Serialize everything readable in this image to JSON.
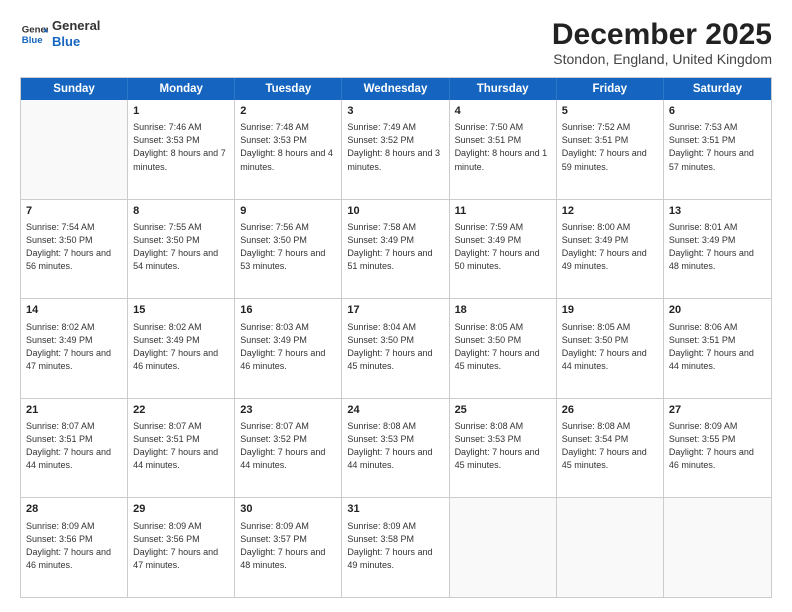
{
  "header": {
    "logo_line1": "General",
    "logo_line2": "Blue",
    "title": "December 2025",
    "subtitle": "Stondon, England, United Kingdom"
  },
  "days_of_week": [
    "Sunday",
    "Monday",
    "Tuesday",
    "Wednesday",
    "Thursday",
    "Friday",
    "Saturday"
  ],
  "weeks": [
    [
      {
        "day": "",
        "empty": true
      },
      {
        "day": "1",
        "sunrise": "7:46 AM",
        "sunset": "3:53 PM",
        "daylight": "8 hours and 7 minutes."
      },
      {
        "day": "2",
        "sunrise": "7:48 AM",
        "sunset": "3:53 PM",
        "daylight": "8 hours and 4 minutes."
      },
      {
        "day": "3",
        "sunrise": "7:49 AM",
        "sunset": "3:52 PM",
        "daylight": "8 hours and 3 minutes."
      },
      {
        "day": "4",
        "sunrise": "7:50 AM",
        "sunset": "3:51 PM",
        "daylight": "8 hours and 1 minute."
      },
      {
        "day": "5",
        "sunrise": "7:52 AM",
        "sunset": "3:51 PM",
        "daylight": "7 hours and 59 minutes."
      },
      {
        "day": "6",
        "sunrise": "7:53 AM",
        "sunset": "3:51 PM",
        "daylight": "7 hours and 57 minutes."
      }
    ],
    [
      {
        "day": "7",
        "sunrise": "7:54 AM",
        "sunset": "3:50 PM",
        "daylight": "7 hours and 56 minutes."
      },
      {
        "day": "8",
        "sunrise": "7:55 AM",
        "sunset": "3:50 PM",
        "daylight": "7 hours and 54 minutes."
      },
      {
        "day": "9",
        "sunrise": "7:56 AM",
        "sunset": "3:50 PM",
        "daylight": "7 hours and 53 minutes."
      },
      {
        "day": "10",
        "sunrise": "7:58 AM",
        "sunset": "3:49 PM",
        "daylight": "7 hours and 51 minutes."
      },
      {
        "day": "11",
        "sunrise": "7:59 AM",
        "sunset": "3:49 PM",
        "daylight": "7 hours and 50 minutes."
      },
      {
        "day": "12",
        "sunrise": "8:00 AM",
        "sunset": "3:49 PM",
        "daylight": "7 hours and 49 minutes."
      },
      {
        "day": "13",
        "sunrise": "8:01 AM",
        "sunset": "3:49 PM",
        "daylight": "7 hours and 48 minutes."
      }
    ],
    [
      {
        "day": "14",
        "sunrise": "8:02 AM",
        "sunset": "3:49 PM",
        "daylight": "7 hours and 47 minutes."
      },
      {
        "day": "15",
        "sunrise": "8:02 AM",
        "sunset": "3:49 PM",
        "daylight": "7 hours and 46 minutes."
      },
      {
        "day": "16",
        "sunrise": "8:03 AM",
        "sunset": "3:49 PM",
        "daylight": "7 hours and 46 minutes."
      },
      {
        "day": "17",
        "sunrise": "8:04 AM",
        "sunset": "3:50 PM",
        "daylight": "7 hours and 45 minutes."
      },
      {
        "day": "18",
        "sunrise": "8:05 AM",
        "sunset": "3:50 PM",
        "daylight": "7 hours and 45 minutes."
      },
      {
        "day": "19",
        "sunrise": "8:05 AM",
        "sunset": "3:50 PM",
        "daylight": "7 hours and 44 minutes."
      },
      {
        "day": "20",
        "sunrise": "8:06 AM",
        "sunset": "3:51 PM",
        "daylight": "7 hours and 44 minutes."
      }
    ],
    [
      {
        "day": "21",
        "sunrise": "8:07 AM",
        "sunset": "3:51 PM",
        "daylight": "7 hours and 44 minutes."
      },
      {
        "day": "22",
        "sunrise": "8:07 AM",
        "sunset": "3:51 PM",
        "daylight": "7 hours and 44 minutes."
      },
      {
        "day": "23",
        "sunrise": "8:07 AM",
        "sunset": "3:52 PM",
        "daylight": "7 hours and 44 minutes."
      },
      {
        "day": "24",
        "sunrise": "8:08 AM",
        "sunset": "3:53 PM",
        "daylight": "7 hours and 44 minutes."
      },
      {
        "day": "25",
        "sunrise": "8:08 AM",
        "sunset": "3:53 PM",
        "daylight": "7 hours and 45 minutes."
      },
      {
        "day": "26",
        "sunrise": "8:08 AM",
        "sunset": "3:54 PM",
        "daylight": "7 hours and 45 minutes."
      },
      {
        "day": "27",
        "sunrise": "8:09 AM",
        "sunset": "3:55 PM",
        "daylight": "7 hours and 46 minutes."
      }
    ],
    [
      {
        "day": "28",
        "sunrise": "8:09 AM",
        "sunset": "3:56 PM",
        "daylight": "7 hours and 46 minutes."
      },
      {
        "day": "29",
        "sunrise": "8:09 AM",
        "sunset": "3:56 PM",
        "daylight": "7 hours and 47 minutes."
      },
      {
        "day": "30",
        "sunrise": "8:09 AM",
        "sunset": "3:57 PM",
        "daylight": "7 hours and 48 minutes."
      },
      {
        "day": "31",
        "sunrise": "8:09 AM",
        "sunset": "3:58 PM",
        "daylight": "7 hours and 49 minutes."
      },
      {
        "day": "",
        "empty": true
      },
      {
        "day": "",
        "empty": true
      },
      {
        "day": "",
        "empty": true
      }
    ]
  ]
}
